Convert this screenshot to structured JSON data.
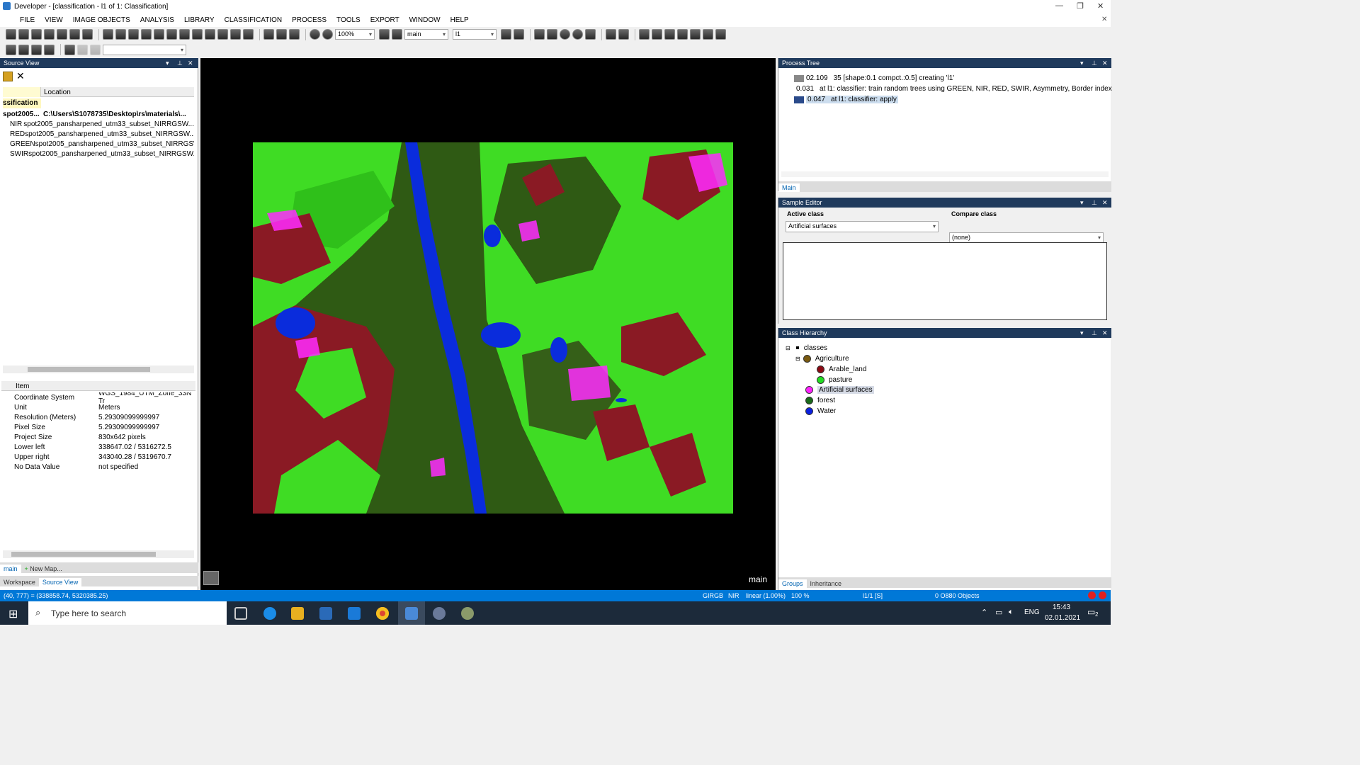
{
  "window": {
    "title": "Developer - [classification - l1 of 1: Classification]"
  },
  "menu": [
    "FILE",
    "VIEW",
    "IMAGE OBJECTS",
    "ANALYSIS",
    "LIBRARY",
    "CLASSIFICATION",
    "PROCESS",
    "TOOLS",
    "EXPORT",
    "WINDOW",
    "HELP"
  ],
  "toolbar": {
    "zoom": "100%",
    "map": "main",
    "level": "l1"
  },
  "source_view": {
    "title": "Source View",
    "col_location": "Location",
    "group": "ssification",
    "rows": [
      {
        "name": "spot2005...",
        "location": "C:\\Users\\S1078735\\Desktop\\rs\\materials\\..."
      },
      {
        "name": "NIR",
        "location": "spot2005_pansharpened_utm33_subset_NIRRGSW..."
      },
      {
        "name": "RED",
        "location": "spot2005_pansharpened_utm33_subset_NIRRGSW..."
      },
      {
        "name": "GREEN",
        "location": "spot2005_pansharpened_utm33_subset_NIRRGSW..."
      },
      {
        "name": "SWIR",
        "location": "spot2005_pansharpened_utm33_subset_NIRRGSW..."
      }
    ],
    "props_header": "Item",
    "props": [
      {
        "k": "Coordinate System",
        "v": "WGS_1984_UTM_Zone_33N  Tr"
      },
      {
        "k": "Unit",
        "v": "Meters"
      },
      {
        "k": "Resolution (Meters)",
        "v": "5.29309099999997"
      },
      {
        "k": "Pixel Size",
        "v": "5.29309099999997"
      },
      {
        "k": "Project Size",
        "v": "830x642 pixels"
      },
      {
        "k": "Lower left",
        "v": "338647.02 / 5316272.5"
      },
      {
        "k": "Upper right",
        "v": "343040.28 / 5319670.7"
      },
      {
        "k": "No Data Value",
        "v": "not specified"
      }
    ],
    "map_tabs": {
      "main": "main",
      "new": "New Map..."
    },
    "bottom_tabs": {
      "workspace": "Workspace",
      "source": "Source View"
    }
  },
  "viewer": {
    "map_label": "main"
  },
  "process_tree": {
    "title": "Process Tree",
    "items": [
      {
        "time": "02.109",
        "text": "35 [shape:0.1 compct.:0.5] creating 'l1'"
      },
      {
        "time": "0.031",
        "text": "at  l1: classifier: train random trees using GREEN, NIR, RED, SWIR, Asymmetry, Border index"
      },
      {
        "time": "0.047",
        "text": "at  l1: classifier: apply"
      }
    ],
    "tab": "Main"
  },
  "sample_editor": {
    "title": "Sample Editor",
    "active_label": "Active class",
    "active_value": "Artificial surfaces",
    "compare_label": "Compare class",
    "compare_value": "(none)"
  },
  "class_hierarchy": {
    "title": "Class Hierarchy",
    "root": "classes",
    "classes": [
      {
        "name": "Agriculture",
        "color": "#7a5a10"
      },
      {
        "name": "Arable_land",
        "color": "#8b0a14"
      },
      {
        "name": "pasture",
        "color": "#22dd22"
      },
      {
        "name": "Artificial surfaces",
        "color": "#ff22ff"
      },
      {
        "name": "forest",
        "color": "#1a6a1a"
      },
      {
        "name": "Water",
        "color": "#0a1fe0"
      }
    ],
    "tabs": {
      "groups": "Groups",
      "inheritance": "Inheritance"
    }
  },
  "status": {
    "coords": "(40, 777) = (338858.74, 5320385.25)",
    "bands": "GIRGB",
    "band": "NIR",
    "stretch": "linear (1.00%)",
    "zoom": "100 %",
    "page": "l1/1  [S]",
    "objects": "0 O880 Objects"
  },
  "taskbar": {
    "search": "Type here to search",
    "lang": "ENG",
    "time": "15:43",
    "date": "02.01.2021",
    "notif": "2"
  }
}
